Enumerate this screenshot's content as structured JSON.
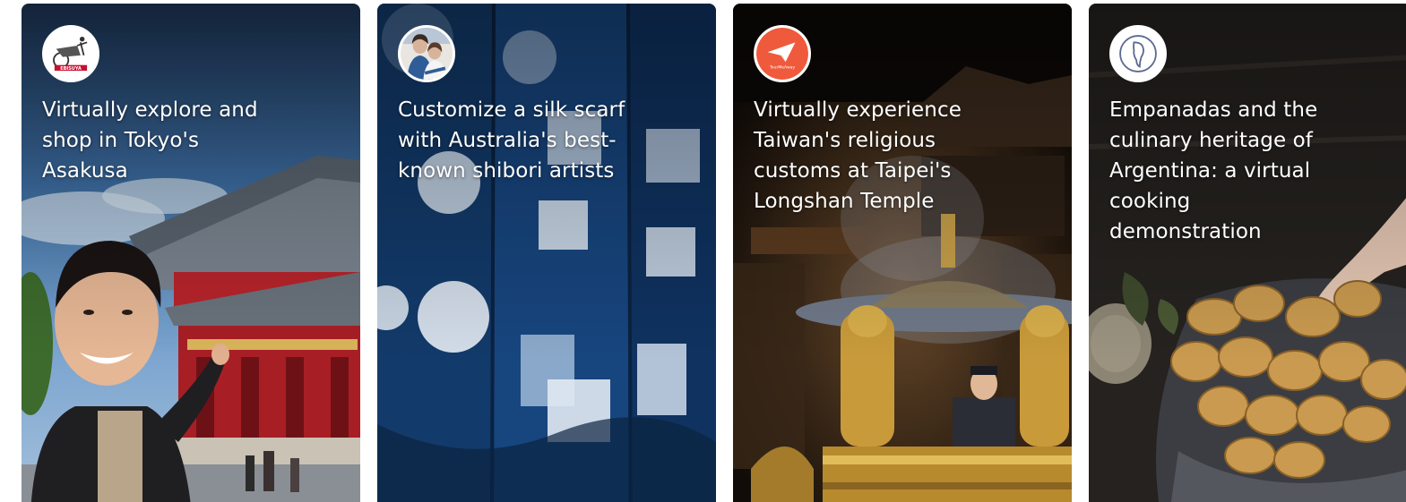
{
  "experiences": [
    {
      "title": "Virtually explore and shop in Tokyo's Asakusa",
      "host_logo": "ebisuya-rickshaw-logo",
      "logo_text": "EBISUYA",
      "scene": "asakusa-temple-with-host"
    },
    {
      "title": "Customize a silk scarf with Australia's best-known shibori artists",
      "host_logo": "artists-portrait-logo",
      "scene": "shibori-indigo-fabric"
    },
    {
      "title": "Virtually experience Taiwan's religious customs at Taipei's Longshan Temple",
      "host_logo": "tourmeaway-paper-plane-logo",
      "logo_text": "TourMeAway",
      "scene": "longshan-temple-incense-burner"
    },
    {
      "title": "Empanadas and the culinary heritage of Argentina: a virtual cooking demonstration",
      "host_logo": "argentina-map-logo",
      "scene": "empanadas-on-cloth"
    }
  ],
  "colors": {
    "ebisuya_red": "#c8102e",
    "tourmeaway_orange": "#ef5a3c",
    "logo_outline_navy": "#5a6a8f"
  }
}
